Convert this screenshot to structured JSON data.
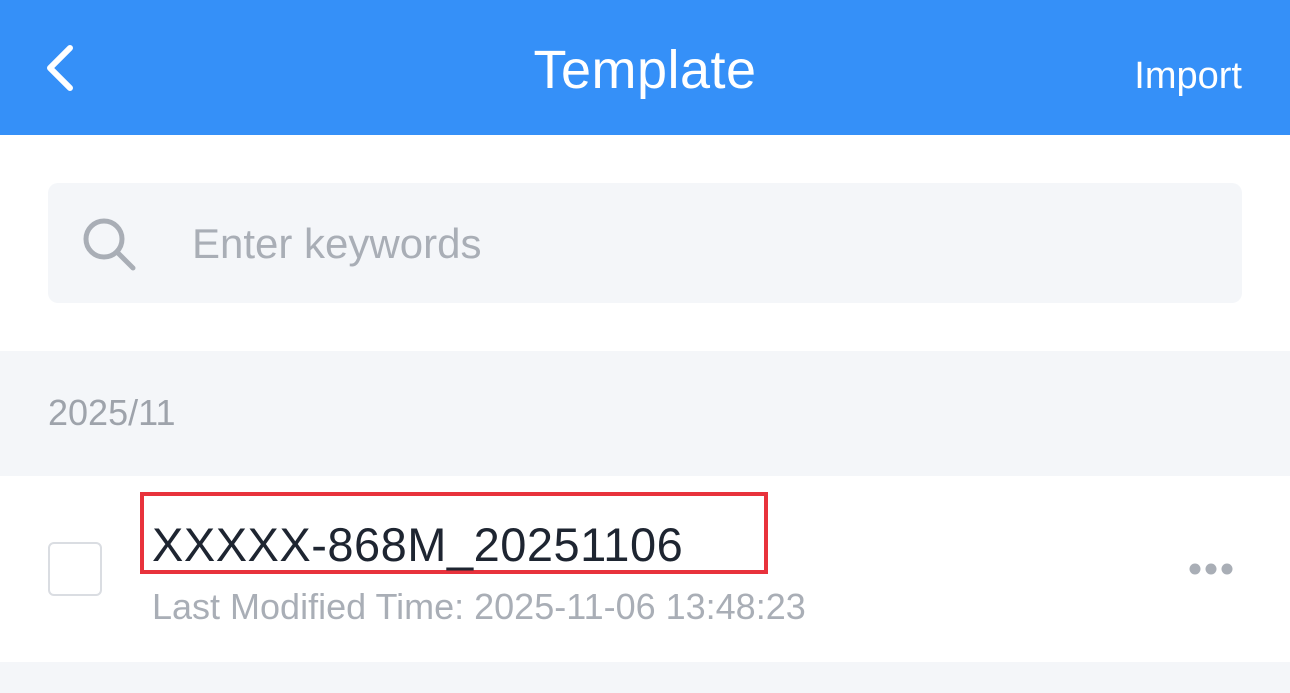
{
  "header": {
    "title": "Template",
    "import_label": "Import",
    "back_icon": "chevron-left-icon"
  },
  "search": {
    "placeholder": "Enter keywords",
    "value": "",
    "icon": "search-icon"
  },
  "groups": [
    {
      "label": "2025/11",
      "items": [
        {
          "name": "XXXXX-868M_20251106",
          "meta_label": "Last Modified Time: ",
          "modified": "2025-11-06 13:48:23",
          "checked": false,
          "highlighted": true
        }
      ]
    }
  ],
  "colors": {
    "primary": "#3590F8",
    "highlight_border": "#E8323C",
    "background_gray": "#F4F6F9",
    "muted_text": "#A9AEB6"
  }
}
